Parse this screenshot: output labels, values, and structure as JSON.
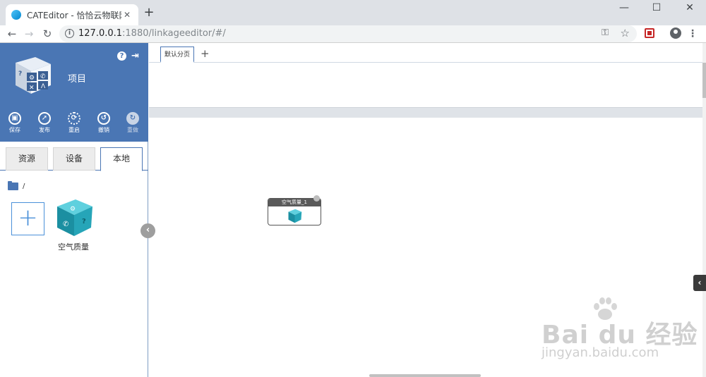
{
  "browser": {
    "tab_title": "CATEditor - 恰恰云物联网应用开",
    "tab_close": "✕",
    "new_tab": "+",
    "url_host": "127.0.0.1",
    "url_path": ":1880/linkageeditor/#/",
    "minimize": "—",
    "maximize": "☐",
    "close": "✕",
    "back": "←",
    "forward": "→",
    "reload": "↻"
  },
  "sidebar": {
    "project_title": "项目",
    "actions": [
      {
        "label": "保存",
        "icon": "save-icon",
        "glyph": "▣"
      },
      {
        "label": "发布",
        "icon": "rocket-icon",
        "glyph": "➚"
      },
      {
        "label": "重启",
        "icon": "restart-icon",
        "glyph": "⟳"
      },
      {
        "label": "撤销",
        "icon": "undo-icon",
        "glyph": "↺"
      },
      {
        "label": "重做",
        "icon": "redo-icon",
        "glyph": "↻"
      }
    ],
    "tabs": [
      "资源",
      "设备",
      "本地"
    ],
    "active_tab": "本地",
    "folder_path": "/",
    "items": [
      {
        "label": "空气质量"
      }
    ]
  },
  "canvas": {
    "tabs": [
      {
        "label": "默认分页"
      }
    ],
    "add_tab": "+",
    "nodes": [
      {
        "title": "空气质量_1"
      }
    ]
  },
  "watermark": {
    "line1": "Bai du 经验",
    "line2": "jingyan.baidu.com"
  },
  "colors": {
    "header_blue": "#4a76b4",
    "cube_teal": "#26a5b8"
  }
}
